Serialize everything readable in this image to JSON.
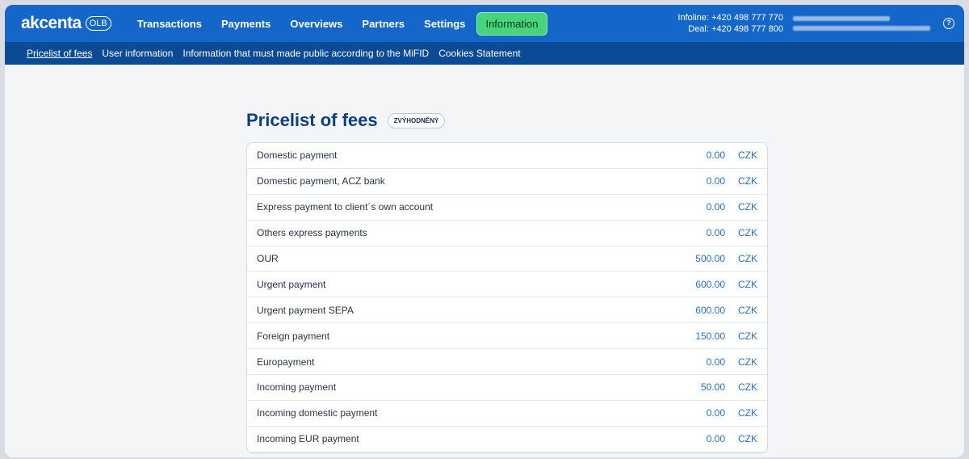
{
  "header": {
    "logo_text": "akcenta",
    "logo_badge": "OLB",
    "nav": [
      {
        "label": "Transactions"
      },
      {
        "label": "Payments"
      },
      {
        "label": "Overviews"
      },
      {
        "label": "Partners"
      },
      {
        "label": "Settings"
      },
      {
        "label": "Information",
        "active": true
      }
    ],
    "infoline": "Infoline: +420 498 777 770",
    "deal": "Deal: +420 498 777 800",
    "help_icon": "question-circle-icon"
  },
  "subnav": [
    {
      "label": "Pricelist of fees",
      "active": true
    },
    {
      "label": "User information"
    },
    {
      "label": "Information that must made public according to the MiFID"
    },
    {
      "label": "Cookies Statement"
    }
  ],
  "main": {
    "title": "Pricelist of fees",
    "badge": "ZVÝHODNĚNÝ",
    "fees": [
      {
        "name": "Domestic payment",
        "amount": "0.00",
        "currency": "CZK"
      },
      {
        "name": "Domestic payment, ACZ bank",
        "amount": "0.00",
        "currency": "CZK"
      },
      {
        "name": "Express payment to client´s own account",
        "amount": "0.00",
        "currency": "CZK"
      },
      {
        "name": "Others express payments",
        "amount": "0.00",
        "currency": "CZK"
      },
      {
        "name": "OUR",
        "amount": "500.00",
        "currency": "CZK"
      },
      {
        "name": "Urgent payment",
        "amount": "600.00",
        "currency": "CZK"
      },
      {
        "name": "Urgent payment SEPA",
        "amount": "600.00",
        "currency": "CZK"
      },
      {
        "name": "Foreign payment",
        "amount": "150.00",
        "currency": "CZK"
      },
      {
        "name": "Europayment",
        "amount": "0.00",
        "currency": "CZK"
      },
      {
        "name": "Incoming payment",
        "amount": "50.00",
        "currency": "CZK"
      },
      {
        "name": "Incoming domestic payment",
        "amount": "0.00",
        "currency": "CZK"
      },
      {
        "name": "Incoming EUR payment",
        "amount": "0.00",
        "currency": "CZK"
      }
    ]
  },
  "colors": {
    "topbar": "#1467c8",
    "subnav": "#0b4a95",
    "active_nav": "#47d47a",
    "title": "#0f3e84"
  }
}
